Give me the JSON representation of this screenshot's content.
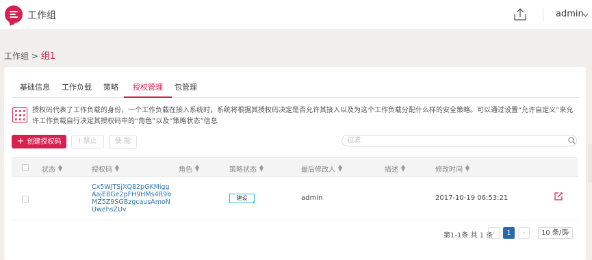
{
  "header": {
    "title": "工作组",
    "user": "admin",
    "logo_icon": "chat-list-logo-icon",
    "upload_icon": "upload-icon",
    "accent": "#d6204e"
  },
  "breadcrumb": {
    "parent": "工作组",
    "separator": " > ",
    "current": "组1"
  },
  "tabs": [
    {
      "label": "基础信息",
      "active": false
    },
    {
      "label": "工作负载",
      "active": false
    },
    {
      "label": "策略",
      "active": false
    },
    {
      "label": "授权管理",
      "active": true
    },
    {
      "label": "包管理",
      "active": false
    }
  ],
  "info": {
    "text": "授权码代表了工作负载的身份，一个工作负载在接入系统时，系统将根据其授权码决定是否允许其接入以及为这个工作负载分配什么样的安全策略。可以通过设置“允许自定义”来允许工作负载自行决定其授权码中的“角色”以及“策略状态”信息"
  },
  "toolbar": {
    "create_label": "创建授权码",
    "create_plus": "+",
    "disable_label": "! 禁止",
    "enable_label": "使 能",
    "filter_placeholder": "过滤"
  },
  "table": {
    "columns": [
      "状态",
      "授权码",
      "角色",
      "策略状态",
      "最后修改人",
      "描述",
      "修改时间"
    ],
    "rows": [
      {
        "status": "",
        "code": "Cx5WJTSjXQ82pGKMiggAajEBGe2pFH9HMs4R9bMZ5Z9SGBzgcausAmoNUwehsZUv",
        "role": "",
        "policy_state": "建设",
        "modified_by": "admin",
        "description": "",
        "modified_time": "2017-10-19 06:53:21"
      }
    ]
  },
  "pagination": {
    "summary": "第1-1条 共 1 条",
    "prev": "‹",
    "current_page": "1",
    "next": "›",
    "page_size": "10 条/页"
  }
}
